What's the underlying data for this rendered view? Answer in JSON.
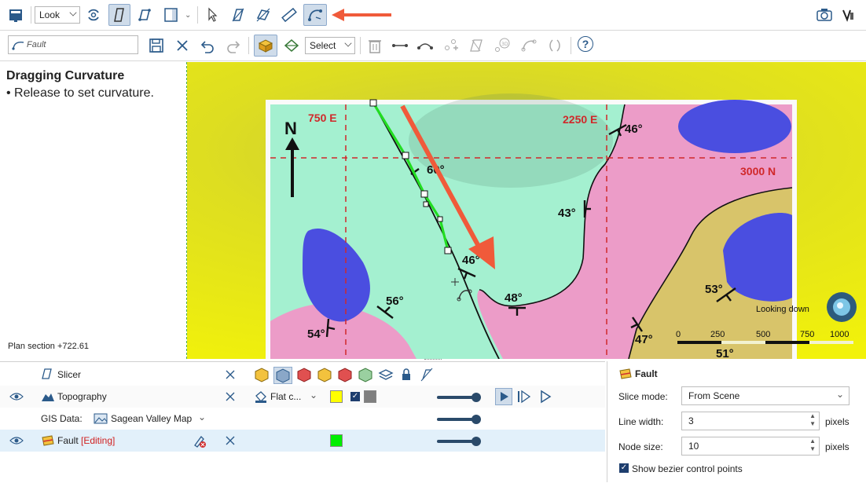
{
  "toolbar1": {
    "look_label": "Look",
    "arrow_color": "#f05a3a"
  },
  "toolbar2": {
    "object_name": "Fault",
    "select_label": "Select",
    "help_label": "?"
  },
  "info": {
    "title": "Dragging Curvature",
    "bullet": "• Release to set curvature.",
    "plan_section": "Plan section +722.61"
  },
  "map": {
    "grid_labels": {
      "e750": "750 E",
      "e2250": "2250 E",
      "n3000": "3000 N"
    },
    "north_label": "N",
    "dips": [
      "46°",
      "60°",
      "43°",
      "46°",
      "48°",
      "56°",
      "54°",
      "53°",
      "47°",
      "51°"
    ],
    "compass_label": "Looking down",
    "scale_labels": [
      "0",
      "250",
      "500",
      "750",
      "1000"
    ],
    "colors": {
      "background": "#eaea10",
      "green_unit": "#a4f0d0",
      "pink_unit": "#ec9cc8",
      "blue_unit": "#4a4ee0",
      "tan_unit": "#d8c46a",
      "fault_line": "#22dd22"
    }
  },
  "layers": {
    "slicer": {
      "name": "Slicer"
    },
    "topography": {
      "name": "Topography",
      "style": "Flat c...",
      "color1": "#ffff00",
      "color2": "#7f7f7f"
    },
    "gis": {
      "label": "GIS Data:",
      "name": "Sagean Valley Map"
    },
    "fault": {
      "name": "Fault",
      "status": "[Editing]",
      "color": "#00ee00"
    }
  },
  "props": {
    "title": "Fault",
    "slice_mode_label": "Slice mode:",
    "slice_mode_value": "From Scene",
    "line_width_label": "Line width:",
    "line_width_value": "3",
    "node_size_label": "Node size:",
    "node_size_value": "10",
    "units": "pixels",
    "bezier_label": "Show bezier control points"
  }
}
